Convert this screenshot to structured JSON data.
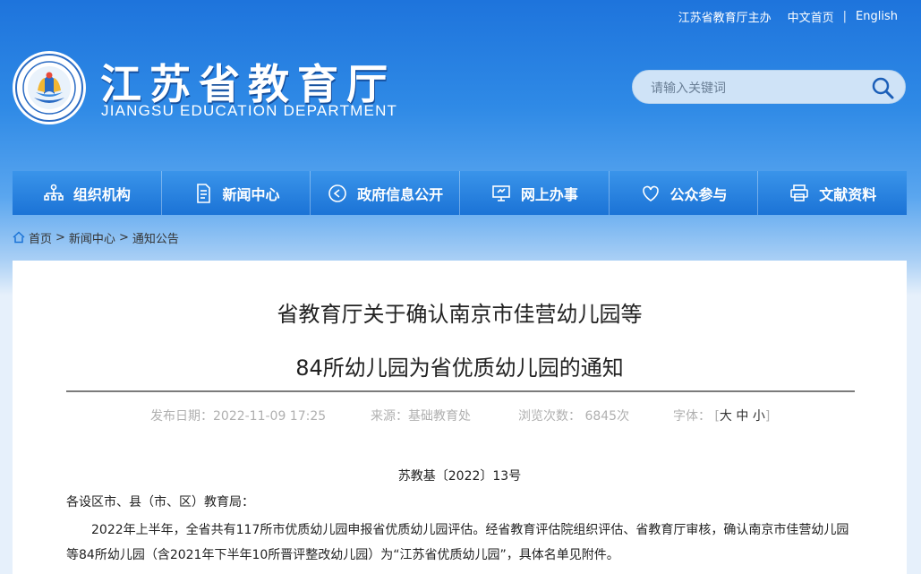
{
  "toplinks": {
    "host": "江苏省教育厅主办",
    "home": "中文首页",
    "sep": "|",
    "english": "English"
  },
  "header": {
    "title": "江苏省教育厅",
    "subtitle": "JIANGSU EDUCATION DEPARTMENT",
    "logo_icon": "seal-logo-icon"
  },
  "search": {
    "placeholder": "请输入关键词",
    "icon": "search-icon"
  },
  "nav": [
    {
      "label": "组织机构",
      "icon": "org-chart-icon"
    },
    {
      "label": "新闻中心",
      "icon": "document-icon"
    },
    {
      "label": "政府信息公开",
      "icon": "play-circle-icon"
    },
    {
      "label": "网上办事",
      "icon": "monitor-icon"
    },
    {
      "label": "公众参与",
      "icon": "heart-icon"
    },
    {
      "label": "文献资料",
      "icon": "printer-icon"
    }
  ],
  "breadcrumb": {
    "home": "首页",
    "sep1": ">",
    "news": "新闻中心",
    "sep2": ">",
    "notice": "通知公告",
    "icon": "home-icon"
  },
  "article": {
    "title_line1": "省教育厅关于确认南京市佳营幼儿园等",
    "title_line2": "84所幼儿园为省优质幼儿园的通知",
    "meta": {
      "date_label": "发布日期：",
      "date": "2022-11-09 17:25",
      "source_label": "来源：",
      "source": "基础教育处",
      "views_label": "浏览次数：",
      "views": "6845次",
      "fontsize_label": "字体：",
      "fs_open": "[",
      "fs_large": "大",
      "fs_medium": "中",
      "fs_small": "小",
      "fs_close": "]"
    },
    "doc_number": "苏教基〔2022〕13号",
    "salutation": "各设区市、县（市、区）教育局：",
    "paragraph1": "2022年上半年，全省共有117所市优质幼儿园申报省优质幼儿园评估。经省教育评估院组织评估、省教育厅审核，确认南京市佳营幼儿园等84所幼儿园（含2021年下半年10所晋评整改幼儿园）为“江苏省优质幼儿园”，具体名单见附件。"
  },
  "colors": {
    "nav": "#1b73d6",
    "header_bg": "#1e74dc",
    "page_bg": "#e6f0fb"
  }
}
